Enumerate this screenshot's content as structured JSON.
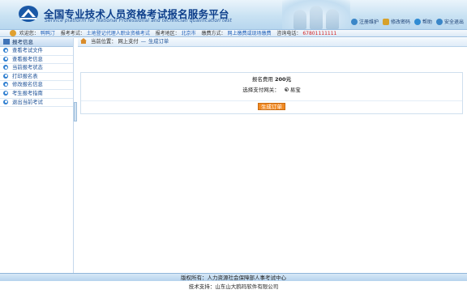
{
  "header": {
    "title": "全国专业技术人员资格考试报名服务平台",
    "subtitle": "Service platform for National Professional and technician qualification test",
    "actions": [
      {
        "label": "注册维护",
        "icon": "user-edit-icon",
        "color": "#3a86c8"
      },
      {
        "label": "修改密码",
        "icon": "lock-icon",
        "color": "#d7a12b"
      },
      {
        "label": "帮助",
        "icon": "help-icon",
        "color": "#2f8bd3"
      },
      {
        "label": "安全退出",
        "icon": "power-icon",
        "color": "#3a86c8"
      }
    ]
  },
  "info_bar": {
    "welcome_label": "欢迎您：",
    "welcome_value": "鸭鸭汀",
    "exam_label": "报考考试：",
    "exam_value": "土地登记代理人职业资格考试",
    "area_label": "报考地区：",
    "area_value": "北京市",
    "pay_label": "缴费方式：",
    "pay_value": "网上缴费或现场缴费",
    "phone_label": "咨询电话：",
    "phone_value": "67801111111"
  },
  "sidebar": {
    "header": "报考信息",
    "items": [
      {
        "label": "查看考试文件"
      },
      {
        "label": "查看报考信息"
      },
      {
        "label": "当前报考状态"
      },
      {
        "label": "打印报名表"
      },
      {
        "label": "修改报名信息"
      },
      {
        "label": "考生报考指南"
      },
      {
        "label": "退出当前考试"
      }
    ]
  },
  "breadcrumb": {
    "label": "当前位置：",
    "current": "网上支付",
    "separator": "—",
    "sub": "生成订单"
  },
  "payment": {
    "fee_label": "报名费用",
    "fee_value": "200元",
    "gateway_label": "选择支付网关：",
    "gateway_option": "易宝",
    "generate_button": "生成订单"
  },
  "footer": {
    "copyright": "版权所有：人力资源社会保障部人事考试中心",
    "support": "技术支持：山东山大鸥玛软件有限公司"
  },
  "colors": {
    "accent": "#1f5fb8",
    "button": "#f08a24",
    "phone": "#d42020"
  }
}
